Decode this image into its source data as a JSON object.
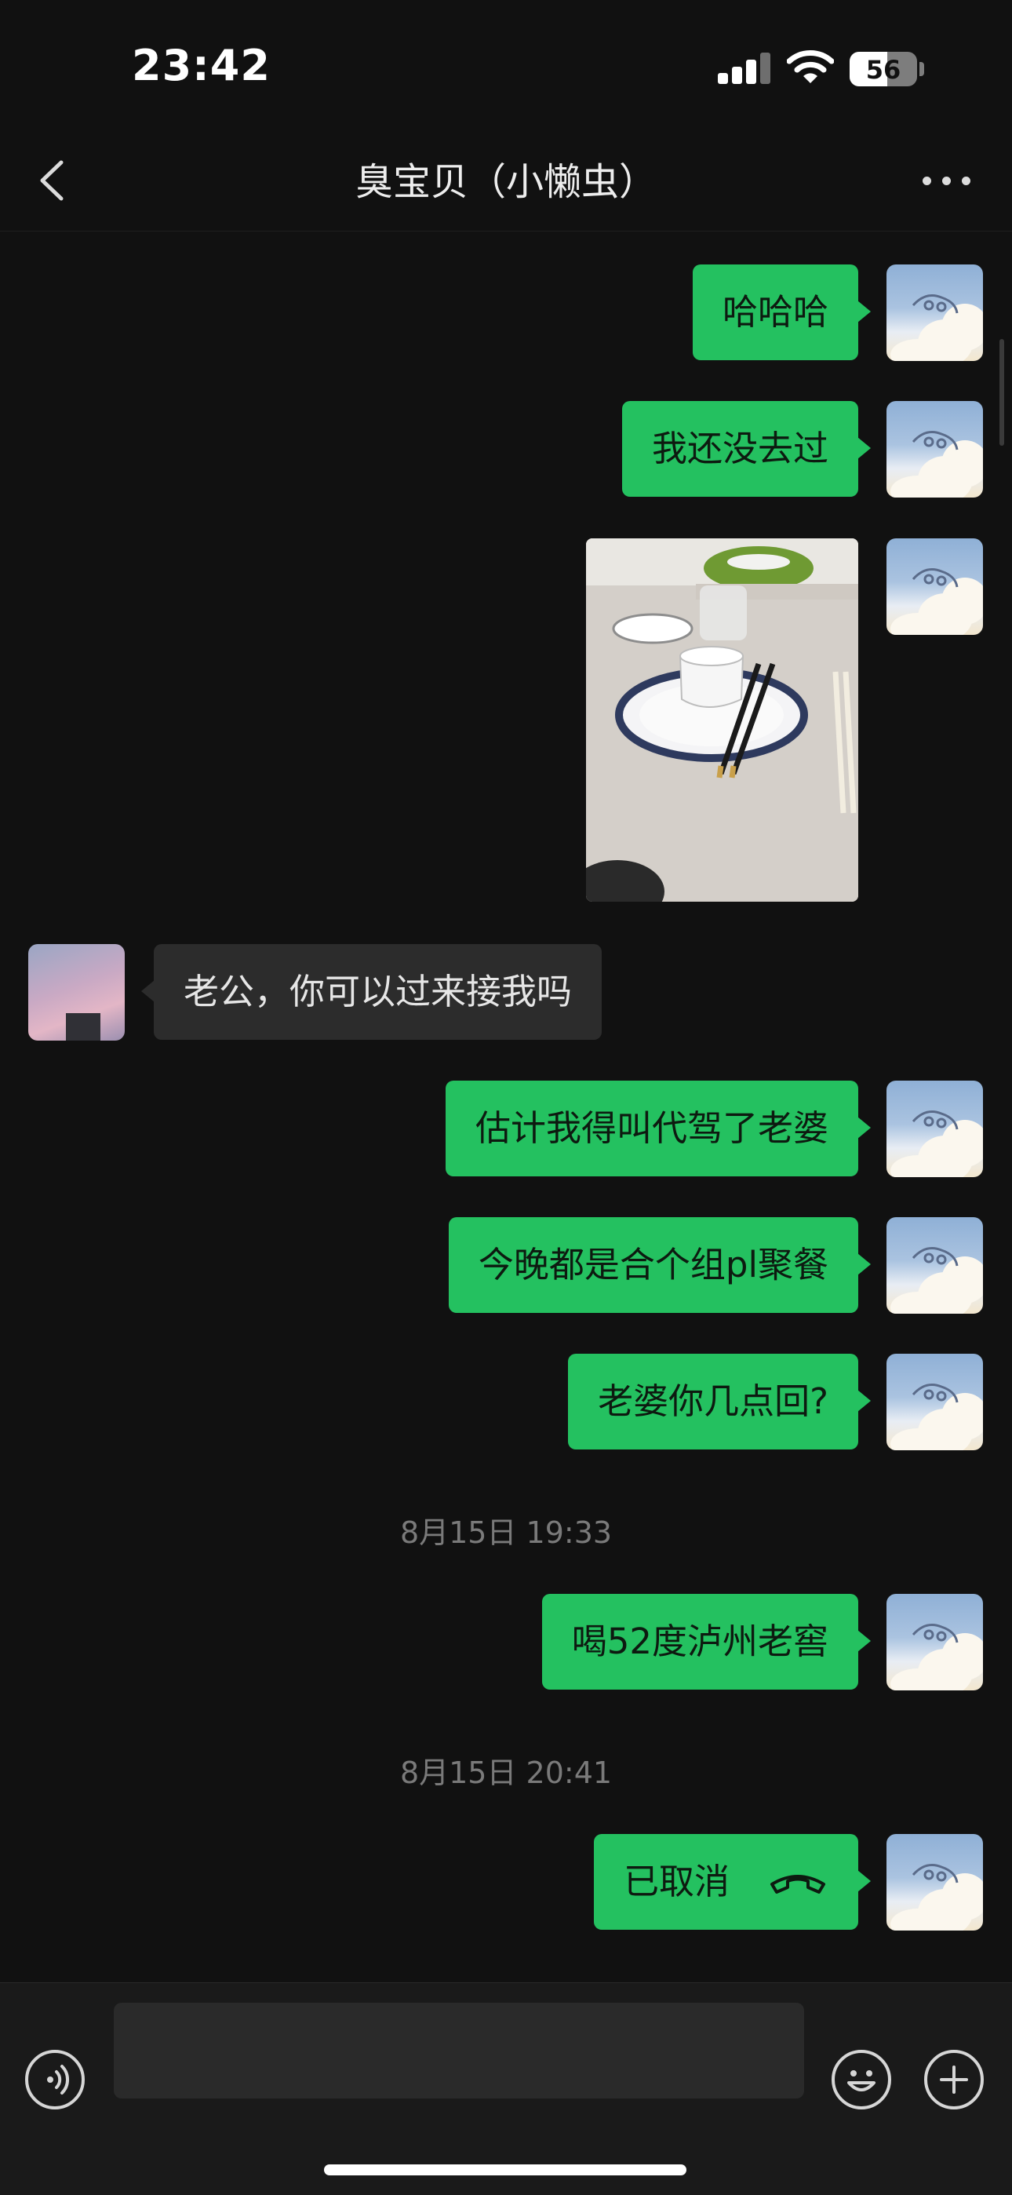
{
  "status": {
    "time": "23:42",
    "battery": "56",
    "battery_level": 0.56
  },
  "header": {
    "title": "臭宝贝（小懒虫）",
    "back_icon": "chevron-left-icon",
    "more_icon": "ellipsis-icon"
  },
  "messages": [
    {
      "from": "me",
      "type": "text",
      "text": "哈哈哈"
    },
    {
      "from": "me",
      "type": "text",
      "text": "我还没去过"
    },
    {
      "from": "me",
      "type": "image",
      "subject": "dining table with plate, cup and chopsticks"
    },
    {
      "from": "her",
      "type": "text",
      "text": "老公，你可以过来接我吗"
    },
    {
      "from": "me",
      "type": "text",
      "text": "估计我得叫代驾了老婆"
    },
    {
      "from": "me",
      "type": "text",
      "text": "今晚都是合个组pl聚餐"
    },
    {
      "from": "me",
      "type": "text",
      "text": "老婆你几点回?"
    },
    {
      "type": "time",
      "text": "8月15日 19:33"
    },
    {
      "from": "me",
      "type": "text",
      "text": "喝52度泸州老窖"
    },
    {
      "type": "time",
      "text": "8月15日 20:41"
    },
    {
      "from": "me",
      "type": "call",
      "text": "已取消",
      "icon": "phone-hangup-icon"
    }
  ],
  "input": {
    "placeholder": "",
    "voice_icon": "voice-icon",
    "emoji_icon": "emoji-icon",
    "plus_icon": "plus-icon"
  },
  "colors": {
    "background": "#111111",
    "outgoing_bubble": "#24c160",
    "incoming_bubble": "#2c2c2c",
    "timestamp": "#7a7a7a"
  }
}
